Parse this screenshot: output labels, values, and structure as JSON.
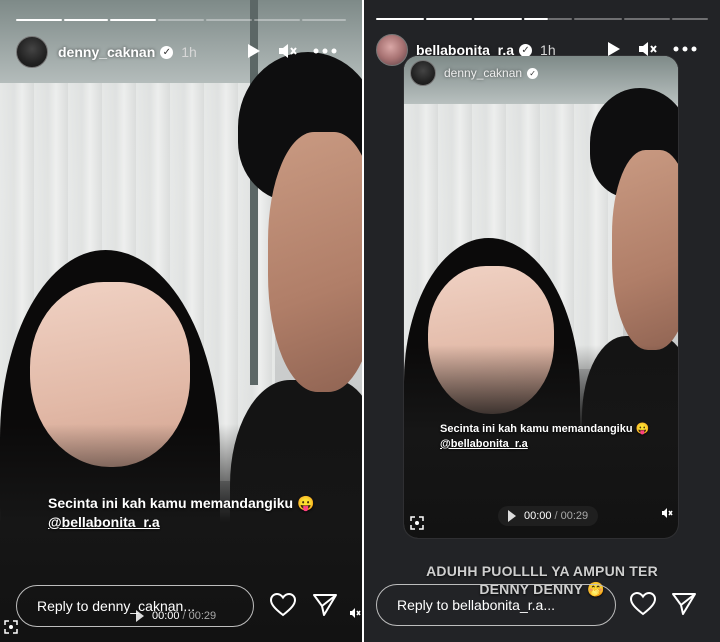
{
  "left_story": {
    "progress": [
      1,
      1,
      1,
      0.35,
      0,
      0,
      0
    ],
    "username": "denny_caknan",
    "time": "1h",
    "caption_line1": "Secinta ini kah kamu memandangiku 😛",
    "mention": "@bellabonita_r.a",
    "reply_placeholder": "Reply to denny_caknan...",
    "audio_current": "00:00",
    "audio_total": "00:29"
  },
  "right_story": {
    "progress": [
      1,
      1,
      1,
      0.5,
      0,
      0,
      0
    ],
    "username": "bellabonita_r.a",
    "time": "1h",
    "shared_username": "denny_caknan",
    "shared_caption_line1": "Secinta ini kah kamu memandangiku 😛",
    "shared_mention": "@bellabonita_r.a",
    "audio_current": "00:00",
    "audio_total": "00:29",
    "comment_line1": "ADUHH PUOLLLL YA AMPUN TER",
    "comment_line2": "DENNY DENNY 🤭",
    "reply_placeholder": "Reply to bellabonita_r.a..."
  },
  "icons": {
    "play": "play-icon",
    "mute": "mute-icon",
    "more": "more-icon",
    "verified": "verified-icon",
    "heart": "heart-icon",
    "send": "send-icon"
  }
}
